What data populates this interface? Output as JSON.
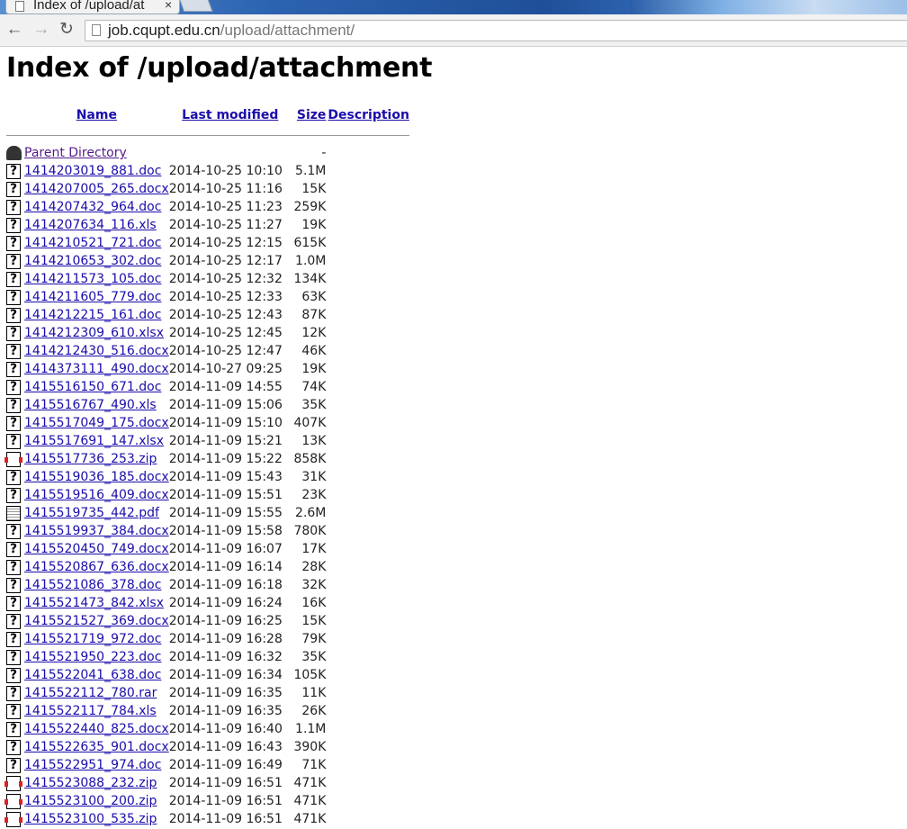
{
  "browser": {
    "tab_title": "Index of /upload/at",
    "tab_close": "×",
    "url_host": "job.cqupt.edu.cn",
    "url_path": "/upload/attachment/",
    "back_glyph": "←",
    "forward_glyph": "→",
    "reload_glyph": "↻"
  },
  "page": {
    "heading": "Index of /upload/attachment",
    "columns": {
      "name": "Name",
      "last_modified": "Last modified",
      "size": "Size",
      "description": "Description"
    },
    "parent": {
      "label": "Parent Directory",
      "size": "-",
      "icon": "back-icon"
    },
    "files": [
      {
        "name": "1414203019_881.doc",
        "date": "2014-10-25 10:10",
        "size": "5.1M",
        "icon": "unknown-file-icon"
      },
      {
        "name": "1414207005_265.docx",
        "date": "2014-10-25 11:16",
        "size": "15K",
        "icon": "unknown-file-icon"
      },
      {
        "name": "1414207432_964.doc",
        "date": "2014-10-25 11:23",
        "size": "259K",
        "icon": "unknown-file-icon"
      },
      {
        "name": "1414207634_116.xls",
        "date": "2014-10-25 11:27",
        "size": "19K",
        "icon": "unknown-file-icon"
      },
      {
        "name": "1414210521_721.doc",
        "date": "2014-10-25 12:15",
        "size": "615K",
        "icon": "unknown-file-icon"
      },
      {
        "name": "1414210653_302.doc",
        "date": "2014-10-25 12:17",
        "size": "1.0M",
        "icon": "unknown-file-icon"
      },
      {
        "name": "1414211573_105.doc",
        "date": "2014-10-25 12:32",
        "size": "134K",
        "icon": "unknown-file-icon"
      },
      {
        "name": "1414211605_779.doc",
        "date": "2014-10-25 12:33",
        "size": "63K",
        "icon": "unknown-file-icon"
      },
      {
        "name": "1414212215_161.doc",
        "date": "2014-10-25 12:43",
        "size": "87K",
        "icon": "unknown-file-icon"
      },
      {
        "name": "1414212309_610.xlsx",
        "date": "2014-10-25 12:45",
        "size": "12K",
        "icon": "unknown-file-icon"
      },
      {
        "name": "1414212430_516.docx",
        "date": "2014-10-25 12:47",
        "size": "46K",
        "icon": "unknown-file-icon"
      },
      {
        "name": "1414373111_490.docx",
        "date": "2014-10-27 09:25",
        "size": "19K",
        "icon": "unknown-file-icon"
      },
      {
        "name": "1415516150_671.doc",
        "date": "2014-11-09 14:55",
        "size": "74K",
        "icon": "unknown-file-icon"
      },
      {
        "name": "1415516767_490.xls",
        "date": "2014-11-09 15:06",
        "size": "35K",
        "icon": "unknown-file-icon"
      },
      {
        "name": "1415517049_175.docx",
        "date": "2014-11-09 15:10",
        "size": "407K",
        "icon": "unknown-file-icon"
      },
      {
        "name": "1415517691_147.xlsx",
        "date": "2014-11-09 15:21",
        "size": "13K",
        "icon": "unknown-file-icon"
      },
      {
        "name": "1415517736_253.zip",
        "date": "2014-11-09 15:22",
        "size": "858K",
        "icon": "compressed-file-icon"
      },
      {
        "name": "1415519036_185.docx",
        "date": "2014-11-09 15:43",
        "size": "31K",
        "icon": "unknown-file-icon"
      },
      {
        "name": "1415519516_409.docx",
        "date": "2014-11-09 15:51",
        "size": "23K",
        "icon": "unknown-file-icon"
      },
      {
        "name": "1415519735_442.pdf",
        "date": "2014-11-09 15:55",
        "size": "2.6M",
        "icon": "layout-file-icon"
      },
      {
        "name": "1415519937_384.docx",
        "date": "2014-11-09 15:58",
        "size": "780K",
        "icon": "unknown-file-icon"
      },
      {
        "name": "1415520450_749.docx",
        "date": "2014-11-09 16:07",
        "size": "17K",
        "icon": "unknown-file-icon"
      },
      {
        "name": "1415520867_636.docx",
        "date": "2014-11-09 16:14",
        "size": "28K",
        "icon": "unknown-file-icon"
      },
      {
        "name": "1415521086_378.doc",
        "date": "2014-11-09 16:18",
        "size": "32K",
        "icon": "unknown-file-icon"
      },
      {
        "name": "1415521473_842.xlsx",
        "date": "2014-11-09 16:24",
        "size": "16K",
        "icon": "unknown-file-icon"
      },
      {
        "name": "1415521527_369.docx",
        "date": "2014-11-09 16:25",
        "size": "15K",
        "icon": "unknown-file-icon"
      },
      {
        "name": "1415521719_972.doc",
        "date": "2014-11-09 16:28",
        "size": "79K",
        "icon": "unknown-file-icon"
      },
      {
        "name": "1415521950_223.doc",
        "date": "2014-11-09 16:32",
        "size": "35K",
        "icon": "unknown-file-icon"
      },
      {
        "name": "1415522041_638.doc",
        "date": "2014-11-09 16:34",
        "size": "105K",
        "icon": "unknown-file-icon"
      },
      {
        "name": "1415522112_780.rar",
        "date": "2014-11-09 16:35",
        "size": "11K",
        "icon": "unknown-file-icon"
      },
      {
        "name": "1415522117_784.xls",
        "date": "2014-11-09 16:35",
        "size": "26K",
        "icon": "unknown-file-icon"
      },
      {
        "name": "1415522440_825.docx",
        "date": "2014-11-09 16:40",
        "size": "1.1M",
        "icon": "unknown-file-icon"
      },
      {
        "name": "1415522635_901.docx",
        "date": "2014-11-09 16:43",
        "size": "390K",
        "icon": "unknown-file-icon"
      },
      {
        "name": "1415522951_974.doc",
        "date": "2014-11-09 16:49",
        "size": "71K",
        "icon": "unknown-file-icon"
      },
      {
        "name": "1415523088_232.zip",
        "date": "2014-11-09 16:51",
        "size": "471K",
        "icon": "compressed-file-icon"
      },
      {
        "name": "1415523100_200.zip",
        "date": "2014-11-09 16:51",
        "size": "471K",
        "icon": "compressed-file-icon"
      },
      {
        "name": "1415523100_535.zip",
        "date": "2014-11-09 16:51",
        "size": "471K",
        "icon": "compressed-file-icon"
      }
    ]
  }
}
